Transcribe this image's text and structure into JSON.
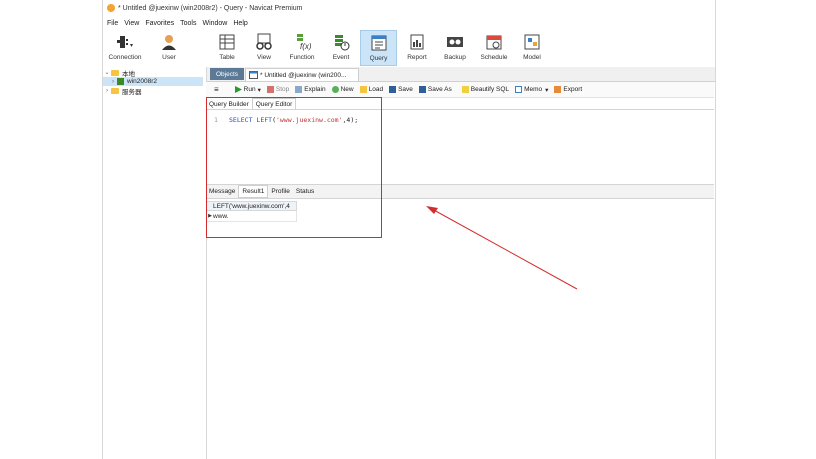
{
  "window": {
    "title": "* Untitled @juexinw (win2008r2) - Query - Navicat Premium"
  },
  "menu": [
    "File",
    "View",
    "Favorites",
    "Tools",
    "Window",
    "Help"
  ],
  "toolbar": {
    "items": [
      {
        "label": "Connection",
        "icon": "connection-icon"
      },
      {
        "label": "User",
        "icon": "user-icon"
      },
      {
        "label": "Table",
        "icon": "table-icon"
      },
      {
        "label": "View",
        "icon": "view-icon"
      },
      {
        "label": "Function",
        "icon": "function-icon"
      },
      {
        "label": "Event",
        "icon": "event-icon"
      },
      {
        "label": "Query",
        "icon": "query-icon",
        "active": true
      },
      {
        "label": "Report",
        "icon": "report-icon"
      },
      {
        "label": "Backup",
        "icon": "backup-icon"
      },
      {
        "label": "Schedule",
        "icon": "schedule-icon"
      },
      {
        "label": "Model",
        "icon": "model-icon"
      }
    ]
  },
  "sidebar": {
    "items": [
      {
        "label": "本地",
        "expanded": true
      },
      {
        "label": "win2008r2",
        "selected": true
      },
      {
        "label": "服务器",
        "expanded": false
      }
    ]
  },
  "tabs": {
    "objects": "Objects",
    "query": "* Untitled @juexinw (win200..."
  },
  "query_toolbar": {
    "run": "Run",
    "stop": "Stop",
    "explain": "Explain",
    "new": "New",
    "load": "Load",
    "save": "Save",
    "save_as": "Save As",
    "beautify": "Beautify SQL",
    "memo": "Memo",
    "export": "Export"
  },
  "subtabs": {
    "builder": "Query Builder",
    "editor": "Query Editor"
  },
  "editor": {
    "line_number": "1",
    "code_keyword_1": "SELECT",
    "code_keyword_2": "LEFT",
    "code_string": "'www.juexinw.com'",
    "code_rest": ",4);"
  },
  "result_tabs": {
    "message": "Message",
    "result": "Result1",
    "profile": "Profile",
    "status": "Status"
  },
  "result": {
    "column": "LEFT('www.juexinw.com',4",
    "value": "www."
  },
  "colors": {
    "annotation": "#d62b2b",
    "active_tab": "#cce4f7",
    "objects_tab": "#5c7a96"
  }
}
